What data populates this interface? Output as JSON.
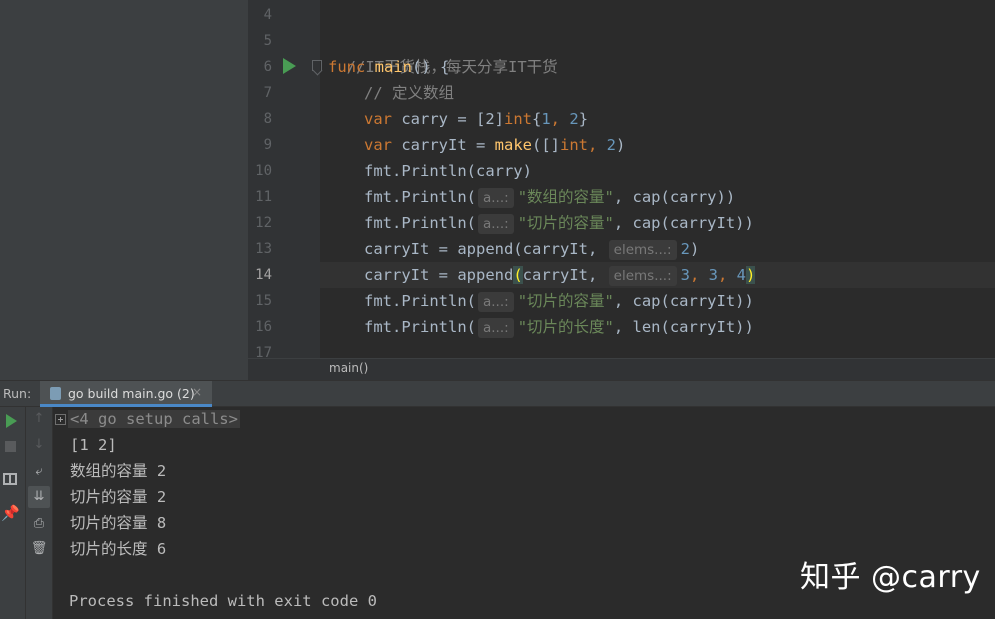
{
  "editor": {
    "line_numbers": [
      "4",
      "5",
      "6",
      "7",
      "8",
      "9",
      "10",
      "11",
      "12",
      "13",
      "14",
      "15",
      "16",
      "17"
    ],
    "lines": {
      "l5": {
        "comment": "//IT干货栈，每天分享IT干货"
      },
      "l6": {
        "kw": "func",
        "name": "main",
        "rest": "() {"
      },
      "l7": {
        "comment": "// 定义数组"
      },
      "l8": {
        "kw": "var",
        "a": " carry = [2]",
        "type": "int",
        "b": "{",
        "n1": "1",
        "c": ", ",
        "n2": "2",
        "d": "}"
      },
      "l9": {
        "kw": "var",
        "a": " carryIt = ",
        "fn": "make",
        "b": "([]",
        "type": "int",
        "c": ", ",
        "n1": "2",
        "d": ")"
      },
      "l10": {
        "text": "fmt.Println(carry)"
      },
      "l11": {
        "pre": "fmt.Println(",
        "hint": "a...:",
        "str": "\"数组的容量\"",
        "post": ", cap(carry))"
      },
      "l12": {
        "pre": "fmt.Println(",
        "hint": "a...:",
        "str": "\"切片的容量\"",
        "post": ", cap(carryIt))"
      },
      "l13": {
        "pre": "carryIt = append(carryIt, ",
        "hint": "elems...:",
        "n1": "2",
        "post": ")"
      },
      "l14": {
        "pre": "carryIt = append",
        "paren": "(",
        "mid": "carryIt, ",
        "hint": "elems...:",
        "n1": "3",
        "c1": ", ",
        "n2": "3",
        "c2": ", ",
        "n3": "4",
        "close": ")"
      },
      "l15": {
        "pre": "fmt.Println(",
        "hint": "a...:",
        "str": "\"切片的容量\"",
        "post": ", cap(carryIt))"
      },
      "l16": {
        "pre": "fmt.Println(",
        "hint": "a...:",
        "str": "\"切片的长度\"",
        "post": ", len(carryIt))"
      }
    },
    "breadcrumb": "main()"
  },
  "run_panel": {
    "label": "Run:",
    "tab_label": "go build main.go (2)",
    "tab_close": "×",
    "icons": [
      "run-icon",
      "stop-icon",
      "layout-icon",
      "pin-icon",
      "up-arrow-icon",
      "down-arrow-icon",
      "soft-wrap-icon",
      "scroll-to-end-icon",
      "print-icon",
      "trash-icon"
    ],
    "console": {
      "setup_calls": "<4 go setup calls>",
      "output": [
        "[1 2]",
        "数组的容量 2",
        "切片的容量 2",
        "切片的容量 8",
        "切片的长度 6"
      ],
      "exit": "Process finished with exit code 0"
    }
  },
  "watermark": "知乎 @carry",
  "colors": {
    "keyword": "#cc7832",
    "function": "#ffc66d",
    "string": "#6a8759",
    "number": "#6897bb",
    "comment": "#808080",
    "run_green": "#499c54"
  }
}
